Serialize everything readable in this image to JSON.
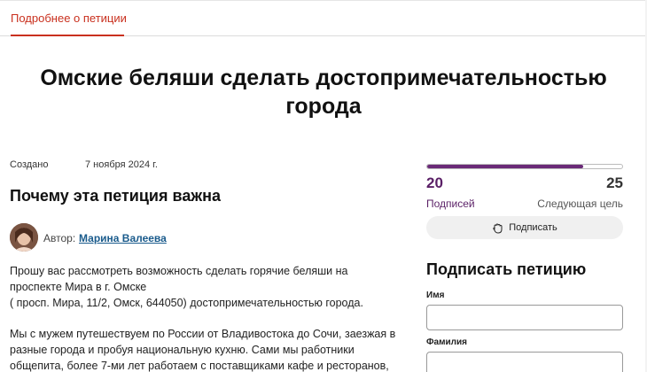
{
  "tabs": {
    "details": "Подробнее о петиции"
  },
  "petition": {
    "title": "Омские беляши сделать достопримечательностью города",
    "created_label": "Создано",
    "created_date": "7 ноября 2024 г.",
    "why_heading": "Почему эта петиция важна",
    "author_label": "Автор:",
    "author_name": "Марина Валеева",
    "body_p1": "Прошу вас рассмотреть возможность сделать горячие беляши на проспекте Мира в г. Омске\n( просп. Мира, 11/2, Омск, 644050) достопримечательностью города.",
    "body_p2": "Мы с мужем путешествуем по России от Владивостока до Сочи, заезжая в разные города и пробуя национальную кухню. Сами мы работники общепита, более 7-ми лет работаем с поставщиками кафе и ресторанов,"
  },
  "progress": {
    "signed": "20",
    "goal": "25",
    "fraction": 0.8,
    "signed_label": "Подписей",
    "goal_label": "Следующая цель",
    "fill_color": "#6a2a77"
  },
  "sign_button": {
    "label": "Подписать",
    "icon": "hand-icon"
  },
  "sign_form": {
    "heading": "Подписать петицию",
    "first_name_label": "Имя",
    "last_name_label": "Фамилия",
    "first_name_value": "",
    "last_name_value": ""
  },
  "colors": {
    "accent": "#c9301e",
    "link": "#1a5b8c",
    "purple": "#5a1f66"
  }
}
